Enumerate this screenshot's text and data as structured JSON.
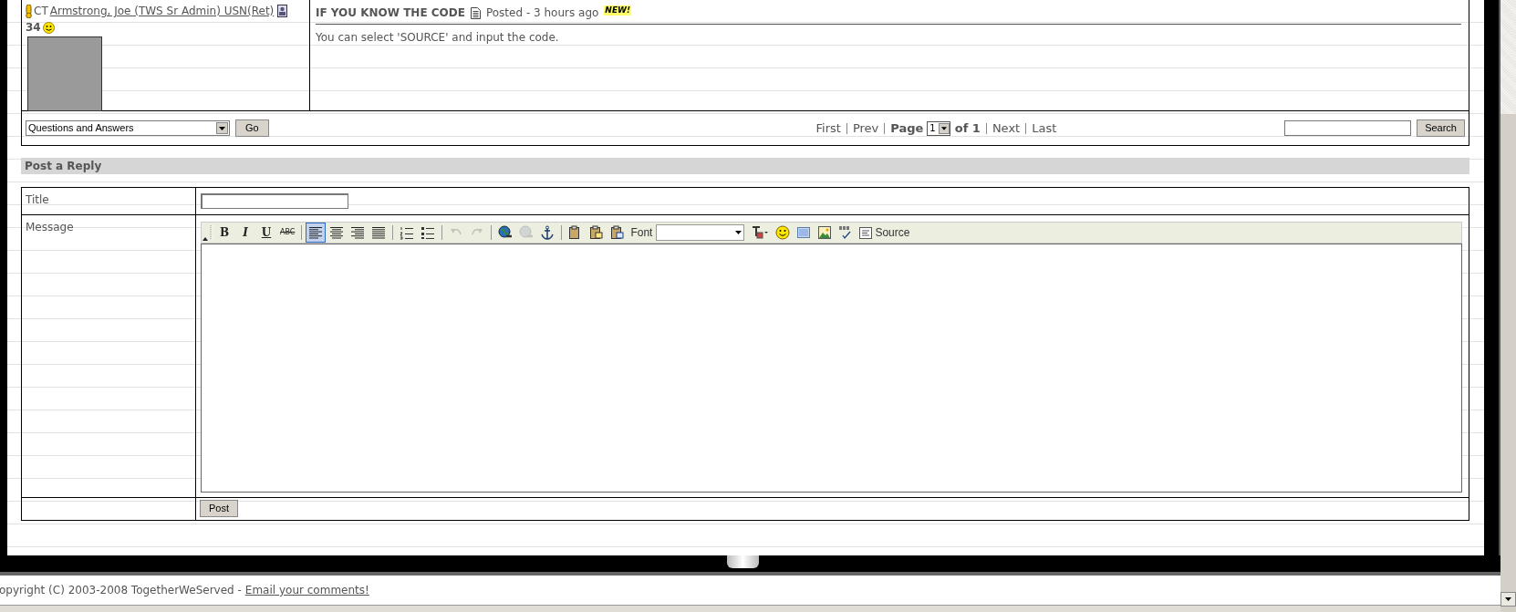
{
  "post": {
    "rank": "CT",
    "author": "Armstrong, Joe (TWS Sr Admin) USN(Ret)",
    "count": "34",
    "title": "IF YOU KNOW THE CODE",
    "posted": "Posted - 3 hours ago",
    "badge": "NEW!",
    "body": "You can select 'SOURCE' and input the code."
  },
  "nav": {
    "forum_select": "Questions and Answers",
    "go": "Go",
    "links_before": [
      {
        "label": "First"
      },
      {
        "label": "Prev"
      }
    ],
    "page_label": "Page",
    "page_select": "1",
    "page_of": "of 1",
    "links_after": [
      {
        "label": "Next"
      },
      {
        "label": "Last"
      }
    ],
    "search_button": "Search"
  },
  "reply": {
    "heading": "Post a Reply",
    "title_label": "Title",
    "message_label": "Message",
    "toolbar": [
      {
        "kind": "collapse"
      },
      {
        "kind": "grip"
      },
      {
        "kind": "bold",
        "label": "B",
        "disabled": false
      },
      {
        "kind": "italic",
        "label": "I",
        "disabled": false
      },
      {
        "kind": "underline",
        "label": "U",
        "disabled": false
      },
      {
        "kind": "strike",
        "label": "ABC",
        "disabled": false
      },
      {
        "kind": "separator"
      },
      {
        "kind": "justify-left",
        "selected": true,
        "disabled": false
      },
      {
        "kind": "justify-center",
        "selected": false,
        "disabled": false
      },
      {
        "kind": "justify-right",
        "selected": false,
        "disabled": false
      },
      {
        "kind": "justify-full",
        "selected": false,
        "disabled": false
      },
      {
        "kind": "separator"
      },
      {
        "kind": "ordered-list",
        "disabled": false
      },
      {
        "kind": "unordered-list",
        "disabled": false
      },
      {
        "kind": "separator"
      },
      {
        "kind": "undo",
        "disabled": true
      },
      {
        "kind": "redo",
        "disabled": true
      },
      {
        "kind": "separator"
      },
      {
        "kind": "link",
        "disabled": false
      },
      {
        "kind": "unlink",
        "disabled": true
      },
      {
        "kind": "anchor",
        "disabled": false
      },
      {
        "kind": "separator"
      },
      {
        "kind": "paste",
        "disabled": false
      },
      {
        "kind": "paste-text",
        "disabled": false
      },
      {
        "kind": "paste-word",
        "disabled": false
      },
      {
        "kind": "font",
        "label": "Font"
      },
      {
        "kind": "text-color",
        "disabled": false
      },
      {
        "kind": "smiley",
        "disabled": false
      },
      {
        "kind": "frame",
        "disabled": false
      },
      {
        "kind": "image",
        "disabled": false
      },
      {
        "kind": "spellcheck",
        "disabled": false
      },
      {
        "kind": "source",
        "label": "Source",
        "disabled": false
      }
    ],
    "post_button": "Post"
  },
  "footer": {
    "copyright": "opyright (C) 2003-2008 TogetherWeServed -",
    "link": "Email your comments!"
  }
}
